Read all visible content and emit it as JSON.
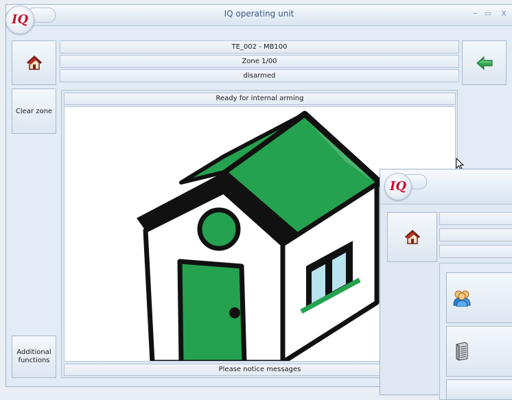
{
  "window": {
    "logo_text": "IQ",
    "title": "IQ operating unit",
    "controls": {
      "minimize": "–",
      "maximize": "▭",
      "close": "x"
    }
  },
  "info": {
    "device": "TE_002 - MB100",
    "zone": "Zone  1/00",
    "state": "disarmed"
  },
  "left_buttons": {
    "home_icon": "house-icon",
    "clear_zone": "Clear zone",
    "additional_functions": "Additional\nfunctions"
  },
  "right_buttons": {
    "back_icon": "arrow-left-icon"
  },
  "main": {
    "status_header": "Ready for internal arming",
    "footer_message": "Please notice messages"
  },
  "colors": {
    "house_green": "#25a24f",
    "accent_blue": "#3b5a86",
    "logo_red": "#c8102e"
  },
  "overlay_window": {
    "logo_text": "IQ",
    "icons": [
      "house-icon",
      "users-icon",
      "server-icon"
    ]
  }
}
